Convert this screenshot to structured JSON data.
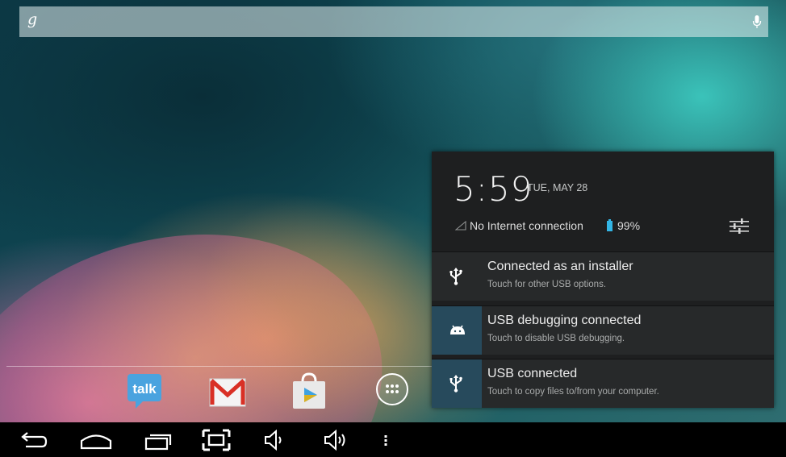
{
  "search": {
    "google_label": "g",
    "mic_icon": "mic-icon"
  },
  "dock": {
    "apps": [
      {
        "name": "Talk",
        "icon_text": "talk",
        "icon": "talk-icon"
      },
      {
        "name": "Gmail",
        "icon_text": "M",
        "icon": "gmail-icon"
      },
      {
        "name": "Play Store",
        "icon": "play-store-icon"
      },
      {
        "name": "All Apps",
        "icon": "all-apps-icon"
      }
    ]
  },
  "notifications": {
    "time": "5:59",
    "date": "TUE, MAY 28",
    "network_text": "No Internet connection",
    "battery_text": "99%",
    "items": [
      {
        "title": "Connected as an installer",
        "subtitle": "Touch for other USB options.",
        "icon": "usb-icon"
      },
      {
        "title": "USB debugging connected",
        "subtitle": "Touch to disable USB debugging.",
        "icon": "android-debug-icon"
      },
      {
        "title": "USB connected",
        "subtitle": "Touch to copy files to/from your computer.",
        "icon": "usb-icon"
      }
    ]
  },
  "navbar": {
    "buttons": [
      "back-icon",
      "home-icon",
      "recents-icon",
      "screenshot-icon",
      "volume-down-icon",
      "volume-up-icon",
      "menu-icon"
    ]
  },
  "colors": {
    "accent": "#33b5e5",
    "panel_bg": "#1e1f20",
    "row_bg": "#27292a",
    "highlight": "#274a5c",
    "gmail_red": "#d93025"
  }
}
